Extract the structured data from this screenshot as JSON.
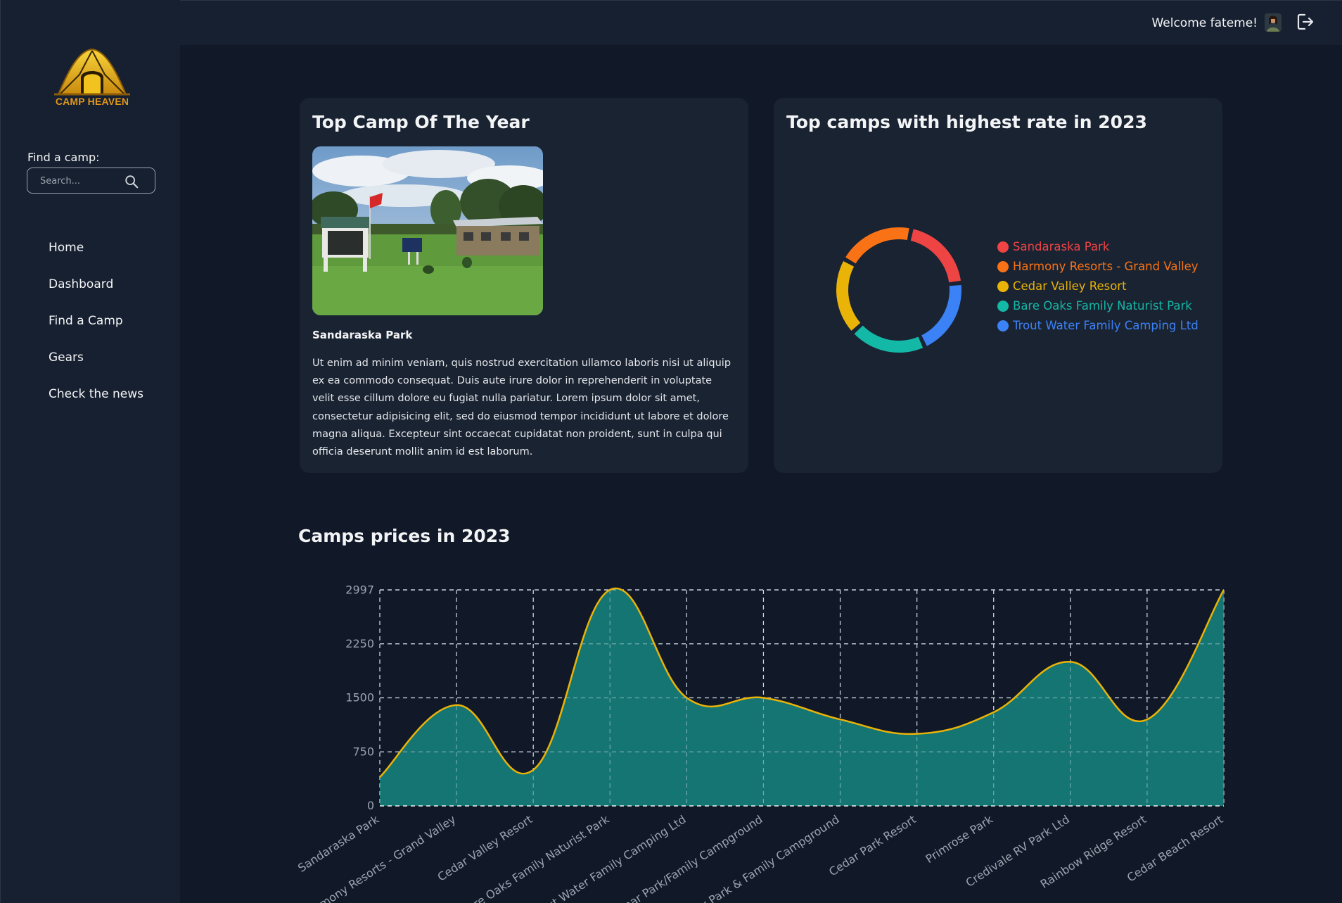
{
  "brand": {
    "name": "CAMP HEAVEN"
  },
  "sidebar": {
    "find_label": "Find a camp:",
    "search_placeholder": "Search...",
    "nav": [
      {
        "label": "Home"
      },
      {
        "label": "Dashboard"
      },
      {
        "label": "Find a Camp"
      },
      {
        "label": "Gears"
      },
      {
        "label": "Check the news"
      }
    ]
  },
  "topbar": {
    "welcome": "Welcome fateme!"
  },
  "top_camp": {
    "title": "Top Camp Of The Year",
    "name": "Sandaraska Park",
    "description": "Ut enim ad minim veniam, quis nostrud exercitation ullamco laboris nisi ut aliquip ex ea commodo consequat. Duis aute irure dolor in reprehenderit in voluptate velit esse cillum dolore eu fugiat nulla pariatur. Lorem ipsum dolor sit amet, consectetur adipisicing elit, sed do eiusmod tempor incididunt ut labore et dolore magna aliqua. Excepteur sint occaecat cupidatat non proident, sunt in culpa qui officia deserunt mollit anim id est laborum."
  },
  "top_rated": {
    "title": "Top camps with highest rate in 2023"
  },
  "prices": {
    "title": "Camps prices in 2023"
  },
  "chart_data": [
    {
      "type": "pie",
      "title": "Top camps with highest rate in 2023",
      "categories": [
        "Sandaraska Park",
        "Harmony Resorts - Grand Valley",
        "Cedar Valley Resort",
        "Bare Oaks Family Naturist Park",
        "Trout Water Family Camping Ltd"
      ],
      "values": [
        20,
        20,
        20,
        20,
        20
      ],
      "colors": [
        "#ef4444",
        "#f97316",
        "#eab308",
        "#14b8a6",
        "#3b82f6"
      ],
      "legend": "right"
    },
    {
      "type": "area",
      "title": "Camps prices in 2023",
      "categories": [
        "Sandaraska Park",
        "Harmony Resorts - Grand Valley",
        "Cedar Valley Resort",
        "Bare Oaks Family Naturist Park",
        "Trout Water Family Camping Ltd",
        "Bear Park/Family Campground",
        "Deer Park & Family Campground",
        "Cedar Park Resort",
        "Primrose Park",
        "Credivale RV Park Ltd",
        "Rainbow Ridge Resort",
        "Cedar Beach Resort"
      ],
      "values": [
        400,
        1400,
        500,
        3000,
        1500,
        1500,
        1200,
        1000,
        1300,
        2000,
        1200,
        3000
      ],
      "yticks": [
        0,
        750,
        1500,
        2250,
        2997
      ],
      "ylim": [
        0,
        3000
      ],
      "grid": true,
      "colors": {
        "line": "#eab308",
        "fill": "#167e78"
      }
    }
  ]
}
